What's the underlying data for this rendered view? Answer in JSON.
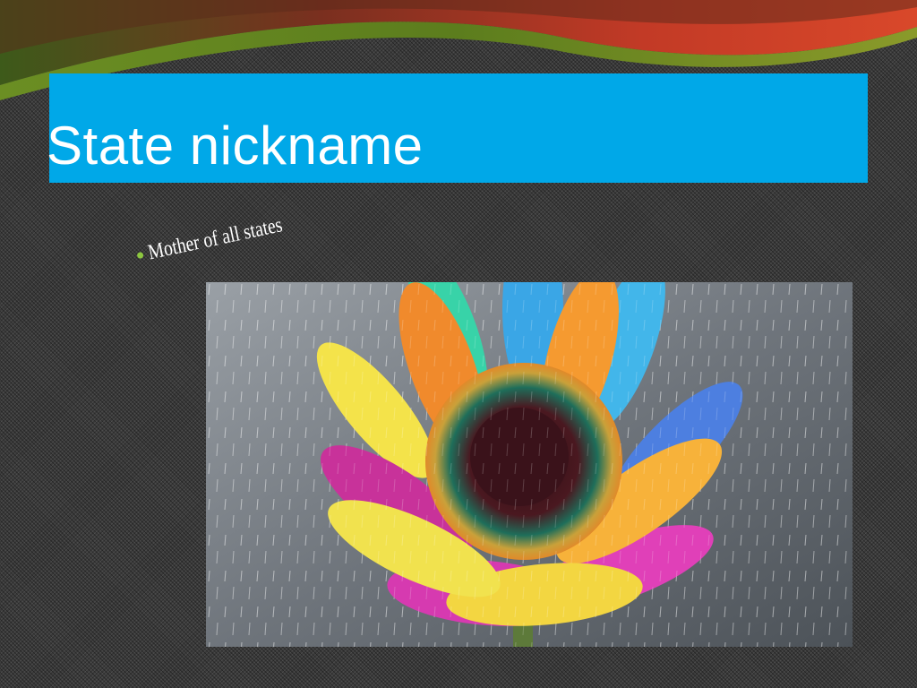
{
  "slide": {
    "title": "State nickname",
    "bullet": "Mother of all states"
  },
  "image": {
    "subject": "rainbow-colored gerbera daisy in rain",
    "icon": "flower-photo"
  },
  "colors": {
    "background": "#3a3a3a",
    "title_bar": "#00a8e8",
    "title_text": "#ffffff",
    "bullet_marker": "#8cc63f",
    "swoosh_red": "#c0392b",
    "swoosh_green": "#6b8e23"
  }
}
